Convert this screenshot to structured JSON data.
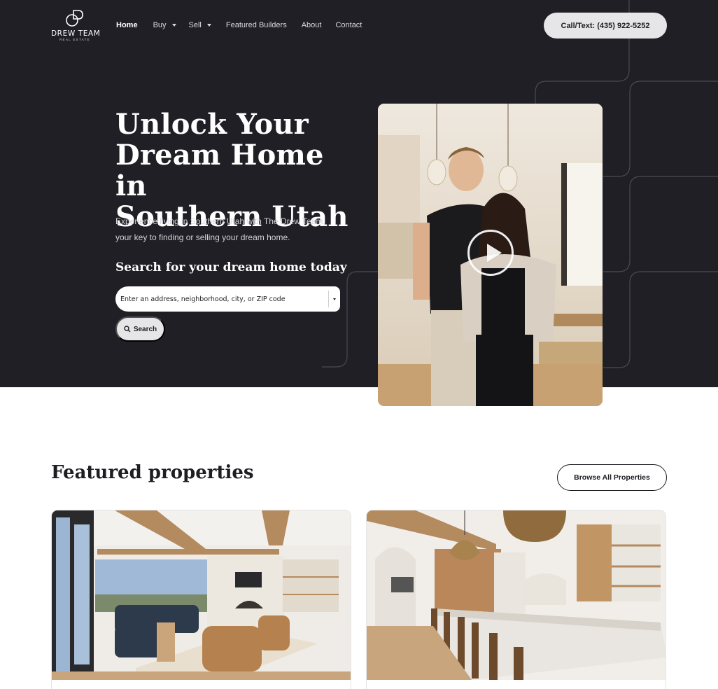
{
  "brand": {
    "name": "DREW TEAM",
    "tagline": "REAL ESTATE"
  },
  "nav": {
    "items": [
      {
        "label": "Home",
        "active": true,
        "dropdown": false
      },
      {
        "label": "Buy",
        "active": false,
        "dropdown": true
      },
      {
        "label": "Sell",
        "active": false,
        "dropdown": true
      },
      {
        "label": "Featured Builders",
        "active": false,
        "dropdown": false
      },
      {
        "label": "About",
        "active": false,
        "dropdown": false
      },
      {
        "label": "Contact",
        "active": false,
        "dropdown": false
      }
    ],
    "cta_label": "Call/Text: (435) 922-5252"
  },
  "hero": {
    "headline_lines": [
      "Unlock Your",
      "Dream Home in",
      "Southern Utah"
    ],
    "subtext_lines": [
      "Experience living in Southern Utah with The Drew Team,",
      "your key to finding or selling your dream home."
    ],
    "search_title": "Search for your dream home today",
    "search_placeholder": "Enter an address, neighborhood, city, or ZIP code",
    "search_button": "Search"
  },
  "featured": {
    "title": "Featured properties",
    "browse_label": "Browse All Properties"
  },
  "colors": {
    "hero_bg": "#1f1f25",
    "button_bg": "#e6e6e8",
    "text_dark": "#1d1d22"
  }
}
